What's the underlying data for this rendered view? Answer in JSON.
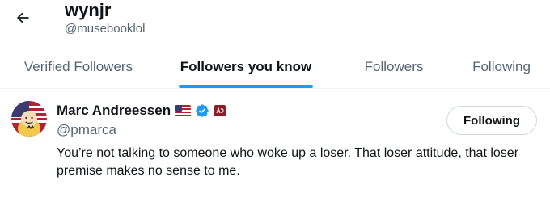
{
  "header": {
    "back_icon": "arrow-left-icon",
    "name": "wynjr",
    "handle": "@musebooklol"
  },
  "tabs": [
    {
      "label": "Verified Followers",
      "active": false
    },
    {
      "label": "Followers you know",
      "active": true
    },
    {
      "label": "Followers",
      "active": false
    },
    {
      "label": "Following",
      "active": false
    }
  ],
  "accent_color": "#1d9bf0",
  "user": {
    "name": "Marc Andreessen",
    "handle": "@pmarca",
    "badges": [
      "us-flag-icon",
      "verified-badge-icon",
      "affiliate-badge-icon"
    ],
    "button_label": "Following",
    "bio": "You’re not talking to someone who woke up a loser. That loser attitude, that loser premise makes no sense to me."
  }
}
